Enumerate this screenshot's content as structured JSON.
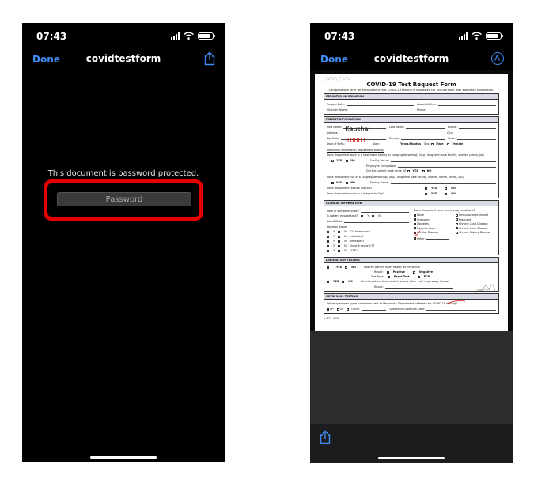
{
  "left_phone": {
    "status": {
      "time": "07:43"
    },
    "nav": {
      "done_label": "Done",
      "title": "covidtestform"
    },
    "message": "This document is password protected.",
    "password": {
      "placeholder": "Password",
      "value": ""
    }
  },
  "right_phone": {
    "status": {
      "time": "07:43"
    },
    "nav": {
      "done_label": "Done",
      "title": "covidtestform"
    },
    "form": {
      "title": "COVID-19 Test Request Form",
      "subtitle": "Complete one form for each patient that COVID-19 testing is requested for. Include form with specimen submission.",
      "reporter": {
        "header": "REPORTER INFORMATION",
        "todays_date": "Today's Date:",
        "hospital_clinic": "Hospital/Clinic:",
        "clinician_name": "Clinician Name:",
        "phone": "Phone:"
      },
      "patient": {
        "header": "PATIENT INFORMATION",
        "first_name_label": "First Name:",
        "first_name_value": "Kaushal",
        "last_name_label": "Last Name:",
        "phone_label": "Phone:",
        "address_label": "Address:",
        "city_label": "City:",
        "zip_label": "Zip Code:",
        "zip_value": "10001",
        "county_label": "County:",
        "state_label": "State:",
        "dob_label": "Date of Birth:",
        "age_label": "Age:",
        "years_months": "Years/Months",
        "sex_label": "Sex:",
        "male": "Male",
        "female": "Female",
        "additional_info": "Additional information required for testing:",
        "q_healthcare": "Does the patient work in a healthcare facility or congregate setting? (e.g., long-term care facility, shelter, prison, jail)",
        "yes": "YES",
        "no": "NO",
        "facility_name": "Facility Name:",
        "employee_occupation": "Employee Occupation:",
        "q_work_while_ill": "Did the patient work while ill?",
        "q_live_congregate": "Does the patient live in a congregate setting? (e.g., long-term care facility, shelter, home, prison, jail)",
        "q_dialysis": "Does the patient receive dialysis?",
        "q_work_dialysis": "Does the patient work in a dialysis facility?"
      },
      "clinical": {
        "header": "CLINICAL INFORMATION",
        "onset": "Date of symptom onset:",
        "hospitalized": "Is patient hospitalized?",
        "y": "Y",
        "n": "N",
        "admit_date": "Admit Date:",
        "hospital_name": "Hospital Name:",
        "icu": "ICU Admission?",
        "intubated": "Intubated?",
        "deceased": "Deceased?",
        "chest_xray": "Chest X-ray or CT?",
        "ecmo": "ECMO",
        "conditions_q": "Does the patient have underlying conditions?",
        "conditions": [
          "None",
          "Immunocompromised",
          "Unknown",
          "Pregnant",
          "Diabetes",
          "Chronic Lung Disease",
          "Hypertension",
          "Chronic Liver Disease",
          "Cardiac Disease",
          "Chronic Kidney Disease",
          "Other:"
        ]
      },
      "lab": {
        "header": "LABORATORY TESTING",
        "influenza_q": "Has the patient been tested for influenza?",
        "result": "Result:",
        "positive": "Positive",
        "negative": "Negative",
        "test_type": "Test Type:",
        "rapid_test": "Rapid Test",
        "pcr": "PCR",
        "other_resp_q": "Has the patient been tested for any other viral respiratory illness?"
      },
      "covid": {
        "header": "COVID 2019 TESTING",
        "specimen_q": "Which specimen types have been sent to Minnesota Department of Health for COVID-19 testing?",
        "np": "NP",
        "op": "OP",
        "other": "Other:",
        "collection_date": "Specimen Collection Date:"
      },
      "version": "v.4.23.2020"
    }
  },
  "colors": {
    "accent": "#3f8cf6",
    "highlight": "#e50000",
    "handwriting_red": "#dd1111"
  },
  "icons": [
    "share-icon",
    "markup-icon",
    "signal-icon",
    "wifi-icon",
    "battery-icon"
  ]
}
